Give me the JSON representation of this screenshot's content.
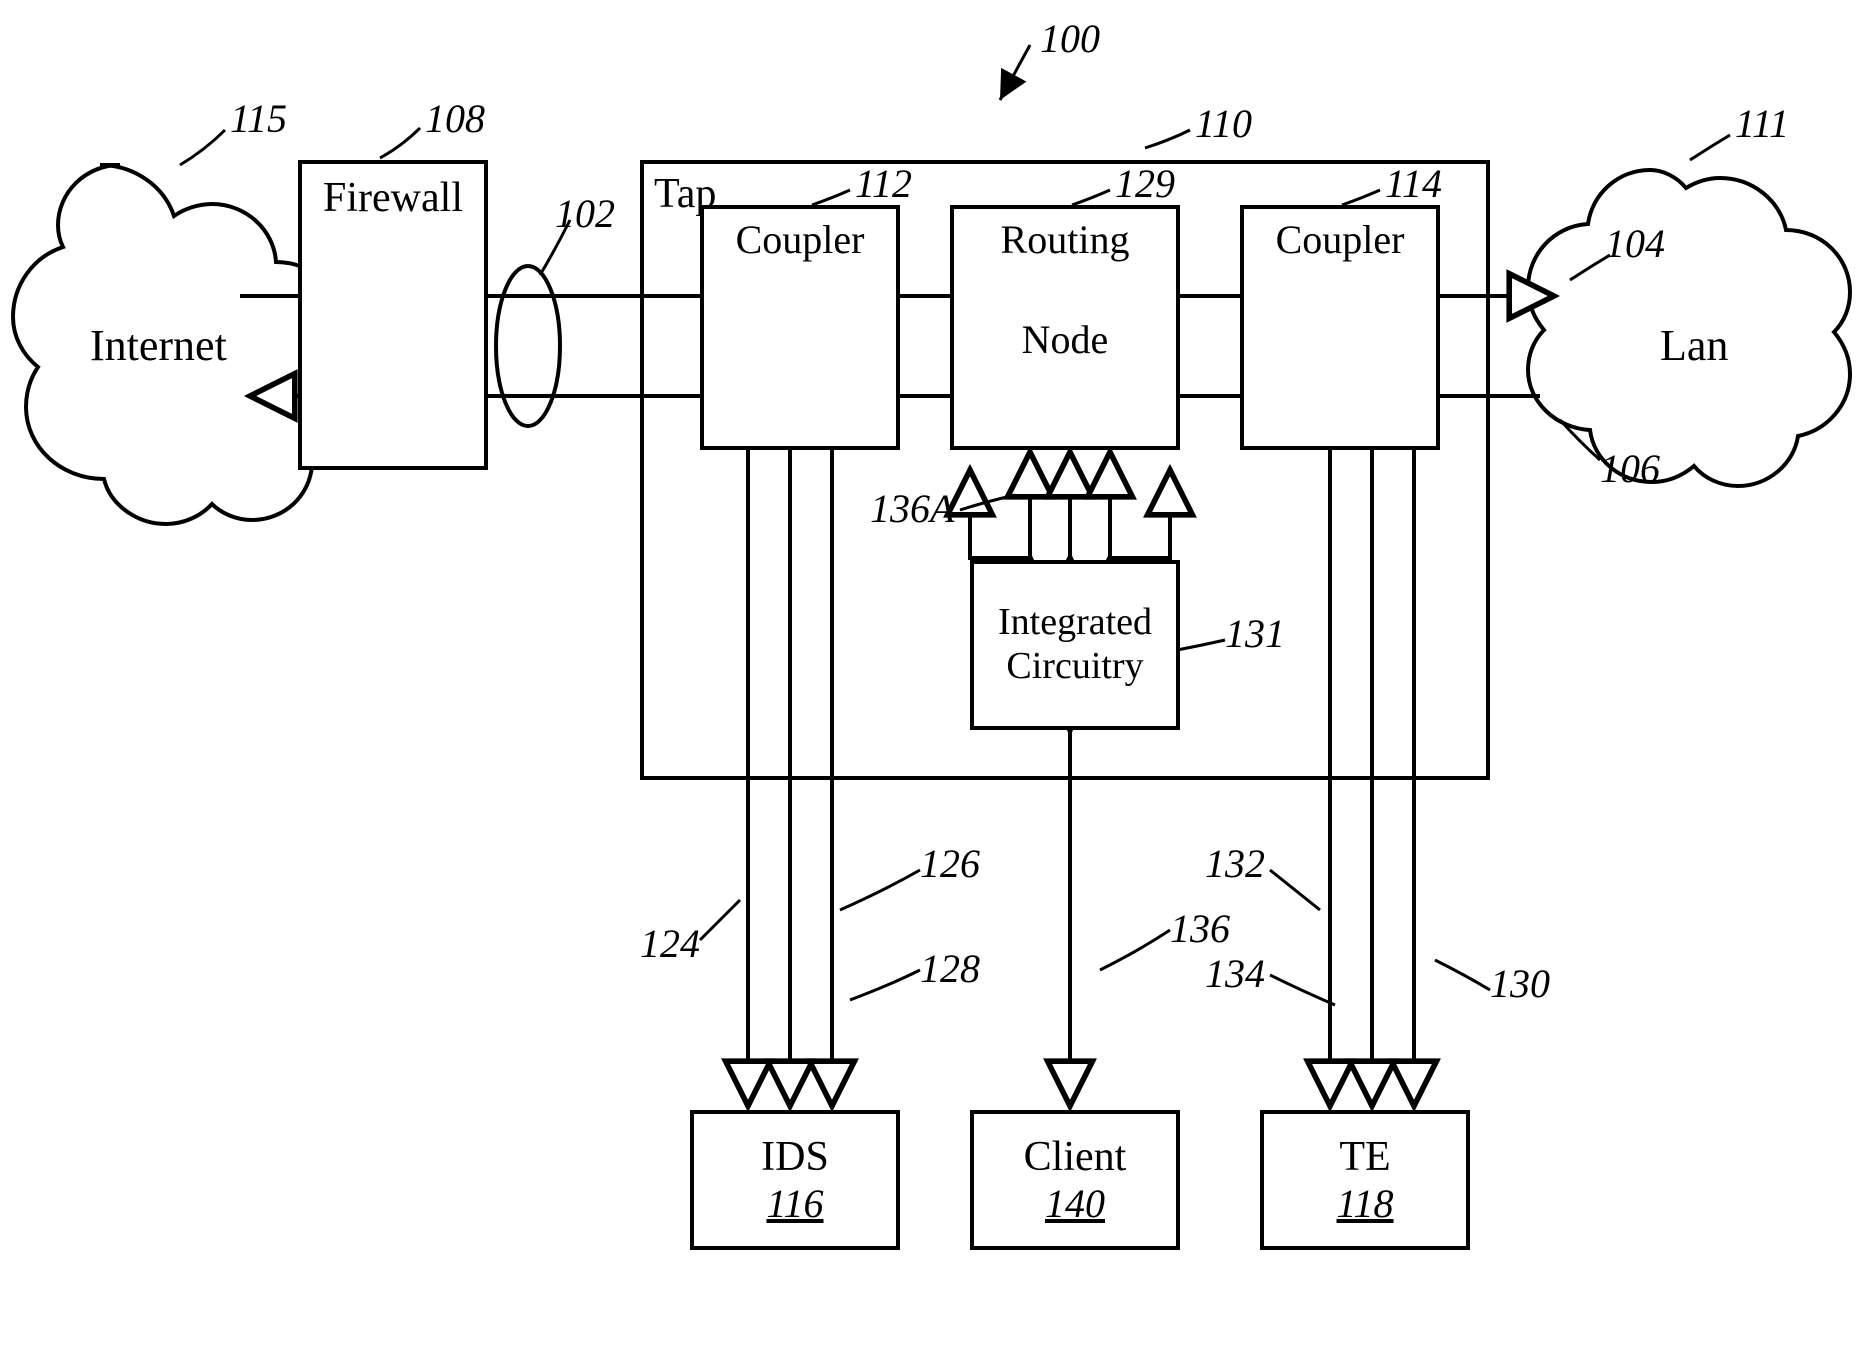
{
  "refs": {
    "system": "100",
    "internet_cloud": "115",
    "firewall": "108",
    "link_loop": "102",
    "tap": "110",
    "coupler_left": "112",
    "routing_node": "129",
    "coupler_right": "114",
    "lan_cloud": "111",
    "right_link": "104",
    "left_link": "106",
    "integrated_circuitry": "131",
    "ic_to_routing": "136A",
    "ids_line_a": "124",
    "ids_line_b": "126",
    "ids_line_c": "128",
    "client_line": "136",
    "te_line_a": "132",
    "te_line_b": "134",
    "te_line_c": "130",
    "ids_num": "116",
    "client_num": "140",
    "te_num": "118"
  },
  "text": {
    "internet": "Internet",
    "firewall": "Firewall",
    "tap": "Tap",
    "coupler": "Coupler",
    "routing": "Routing",
    "node": "Node",
    "lan": "Lan",
    "integrated": "Integrated",
    "circuitry": "Circuitry",
    "ids": "IDS",
    "client": "Client",
    "te": "TE"
  }
}
